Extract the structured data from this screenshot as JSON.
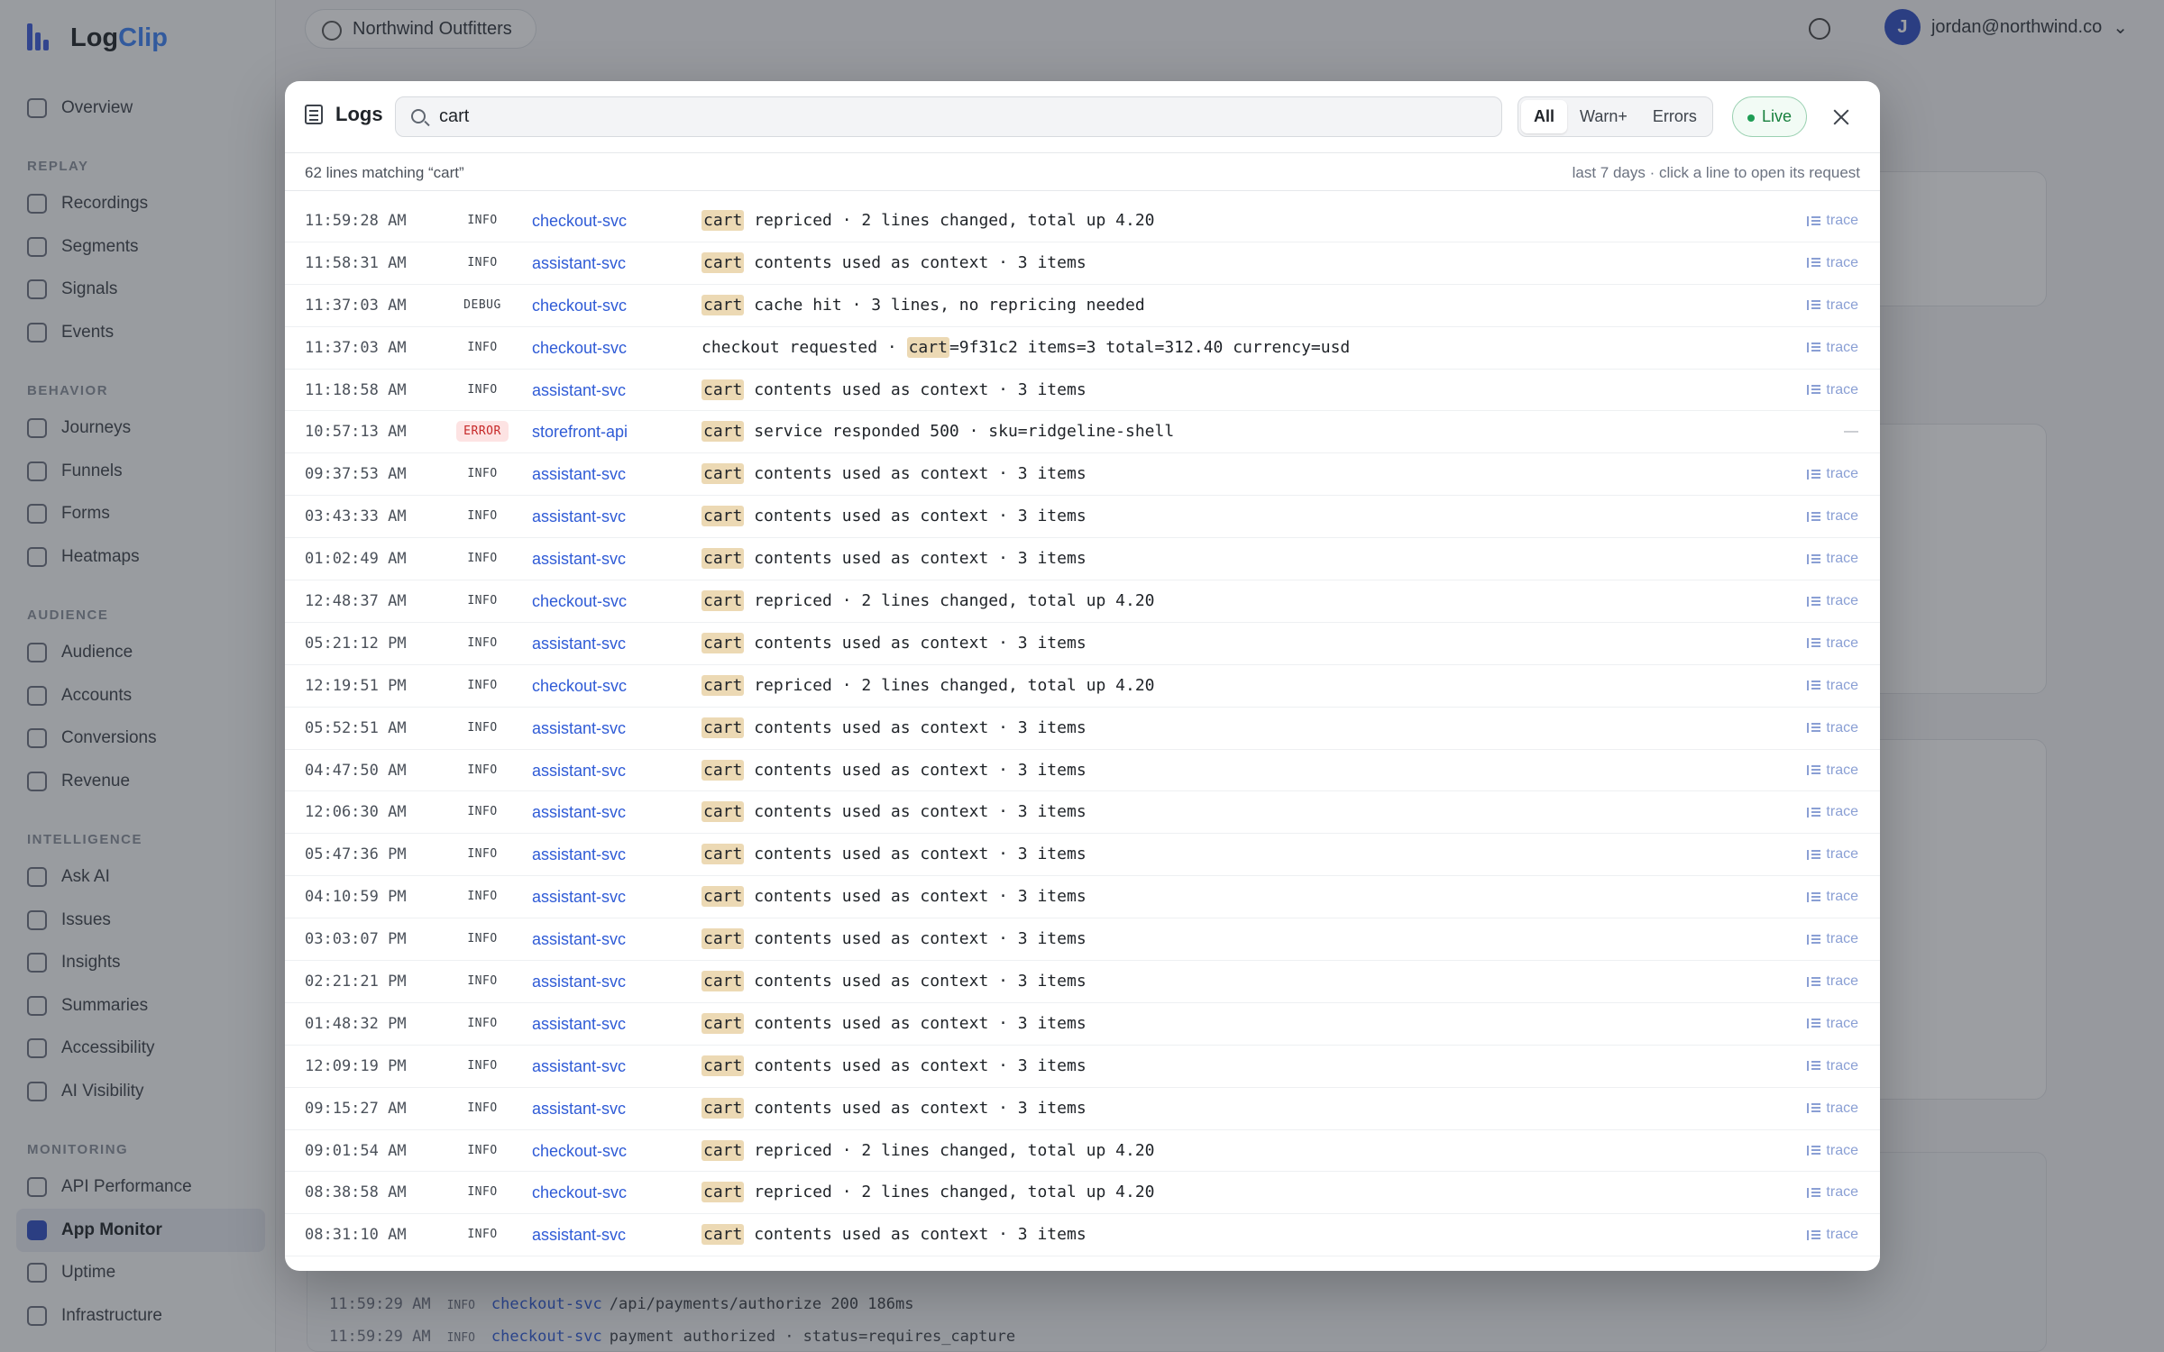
{
  "app": {
    "brand_part1": "Log",
    "brand_part2": "Clip",
    "org_name": "Northwind Outfitters",
    "user_email": "jordan@northwind.co",
    "user_initial": "J"
  },
  "sidebar": {
    "items_top": [
      {
        "label": "Overview"
      }
    ],
    "sections": [
      {
        "title": "REPLAY",
        "items": [
          {
            "label": "Recordings"
          },
          {
            "label": "Segments"
          },
          {
            "label": "Signals"
          },
          {
            "label": "Events"
          }
        ]
      },
      {
        "title": "BEHAVIOR",
        "items": [
          {
            "label": "Journeys"
          },
          {
            "label": "Funnels"
          },
          {
            "label": "Forms"
          },
          {
            "label": "Heatmaps"
          }
        ]
      },
      {
        "title": "AUDIENCE",
        "items": [
          {
            "label": "Audience"
          },
          {
            "label": "Accounts"
          },
          {
            "label": "Conversions"
          },
          {
            "label": "Revenue"
          }
        ]
      },
      {
        "title": "INTELLIGENCE",
        "items": [
          {
            "label": "Ask AI"
          },
          {
            "label": "Issues"
          },
          {
            "label": "Insights"
          },
          {
            "label": "Summaries"
          },
          {
            "label": "Accessibility"
          },
          {
            "label": "AI Visibility"
          }
        ]
      },
      {
        "title": "MONITORING",
        "items": [
          {
            "label": "API Performance"
          },
          {
            "label": "App Monitor",
            "active": true
          },
          {
            "label": "Uptime"
          },
          {
            "label": "Infrastructure"
          }
        ]
      }
    ]
  },
  "background": {
    "log_lines": [
      {
        "time": "11:59:29 AM",
        "level": "INFO",
        "service": "checkout-svc",
        "message": "/api/payments/authorize 200 186ms"
      },
      {
        "time": "11:59:29 AM",
        "level": "INFO",
        "service": "checkout-svc",
        "message": "payment authorized · status=requires_capture"
      }
    ]
  },
  "logs_modal": {
    "title": "Logs",
    "search_value": "cart",
    "filters": [
      {
        "label": "All",
        "active": true
      },
      {
        "label": "Warn+",
        "active": false
      },
      {
        "label": "Errors",
        "active": false
      }
    ],
    "live_label": "Live",
    "summary": "62 lines matching “cart”",
    "hint": "last 7 days · click a line to open its request",
    "trace_label": "trace",
    "no_trace": "—",
    "rows": [
      {
        "time": "11:59:28 AM",
        "level": "INFO",
        "service": "checkout-svc",
        "pre": "",
        "match": "cart",
        "post": " repriced · 2 lines changed, total up 4.20",
        "trace": true
      },
      {
        "time": "11:58:31 AM",
        "level": "INFO",
        "service": "assistant-svc",
        "pre": "",
        "match": "cart",
        "post": " contents used as context · 3 items",
        "trace": true
      },
      {
        "time": "11:37:03 AM",
        "level": "DEBUG",
        "service": "checkout-svc",
        "pre": "",
        "match": "cart",
        "post": " cache hit · 3 lines, no repricing needed",
        "trace": true
      },
      {
        "time": "11:37:03 AM",
        "level": "INFO",
        "service": "checkout-svc",
        "pre": "checkout requested · ",
        "match": "cart",
        "post": "=9f31c2 items=3 total=312.40 currency=usd",
        "trace": true
      },
      {
        "time": "11:18:58 AM",
        "level": "INFO",
        "service": "assistant-svc",
        "pre": "",
        "match": "cart",
        "post": " contents used as context · 3 items",
        "trace": true
      },
      {
        "time": "10:57:13 AM",
        "level": "ERROR",
        "service": "storefront-api",
        "pre": "",
        "match": "cart",
        "post": " service responded 500 · sku=ridgeline-shell",
        "trace": false
      },
      {
        "time": "09:37:53 AM",
        "level": "INFO",
        "service": "assistant-svc",
        "pre": "",
        "match": "cart",
        "post": " contents used as context · 3 items",
        "trace": true
      },
      {
        "time": "03:43:33 AM",
        "level": "INFO",
        "service": "assistant-svc",
        "pre": "",
        "match": "cart",
        "post": " contents used as context · 3 items",
        "trace": true
      },
      {
        "time": "01:02:49 AM",
        "level": "INFO",
        "service": "assistant-svc",
        "pre": "",
        "match": "cart",
        "post": " contents used as context · 3 items",
        "trace": true
      },
      {
        "time": "12:48:37 AM",
        "level": "INFO",
        "service": "checkout-svc",
        "pre": "",
        "match": "cart",
        "post": " repriced · 2 lines changed, total up 4.20",
        "trace": true
      },
      {
        "time": "05:21:12 PM",
        "level": "INFO",
        "service": "assistant-svc",
        "pre": "",
        "match": "cart",
        "post": " contents used as context · 3 items",
        "trace": true
      },
      {
        "time": "12:19:51 PM",
        "level": "INFO",
        "service": "checkout-svc",
        "pre": "",
        "match": "cart",
        "post": " repriced · 2 lines changed, total up 4.20",
        "trace": true
      },
      {
        "time": "05:52:51 AM",
        "level": "INFO",
        "service": "assistant-svc",
        "pre": "",
        "match": "cart",
        "post": " contents used as context · 3 items",
        "trace": true
      },
      {
        "time": "04:47:50 AM",
        "level": "INFO",
        "service": "assistant-svc",
        "pre": "",
        "match": "cart",
        "post": " contents used as context · 3 items",
        "trace": true
      },
      {
        "time": "12:06:30 AM",
        "level": "INFO",
        "service": "assistant-svc",
        "pre": "",
        "match": "cart",
        "post": " contents used as context · 3 items",
        "trace": true
      },
      {
        "time": "05:47:36 PM",
        "level": "INFO",
        "service": "assistant-svc",
        "pre": "",
        "match": "cart",
        "post": " contents used as context · 3 items",
        "trace": true
      },
      {
        "time": "04:10:59 PM",
        "level": "INFO",
        "service": "assistant-svc",
        "pre": "",
        "match": "cart",
        "post": " contents used as context · 3 items",
        "trace": true
      },
      {
        "time": "03:03:07 PM",
        "level": "INFO",
        "service": "assistant-svc",
        "pre": "",
        "match": "cart",
        "post": " contents used as context · 3 items",
        "trace": true
      },
      {
        "time": "02:21:21 PM",
        "level": "INFO",
        "service": "assistant-svc",
        "pre": "",
        "match": "cart",
        "post": " contents used as context · 3 items",
        "trace": true
      },
      {
        "time": "01:48:32 PM",
        "level": "INFO",
        "service": "assistant-svc",
        "pre": "",
        "match": "cart",
        "post": " contents used as context · 3 items",
        "trace": true
      },
      {
        "time": "12:09:19 PM",
        "level": "INFO",
        "service": "assistant-svc",
        "pre": "",
        "match": "cart",
        "post": " contents used as context · 3 items",
        "trace": true
      },
      {
        "time": "09:15:27 AM",
        "level": "INFO",
        "service": "assistant-svc",
        "pre": "",
        "match": "cart",
        "post": " contents used as context · 3 items",
        "trace": true
      },
      {
        "time": "09:01:54 AM",
        "level": "INFO",
        "service": "checkout-svc",
        "pre": "",
        "match": "cart",
        "post": " repriced · 2 lines changed, total up 4.20",
        "trace": true
      },
      {
        "time": "08:38:58 AM",
        "level": "INFO",
        "service": "checkout-svc",
        "pre": "",
        "match": "cart",
        "post": " repriced · 2 lines changed, total up 4.20",
        "trace": true
      },
      {
        "time": "08:31:10 AM",
        "level": "INFO",
        "service": "assistant-svc",
        "pre": "",
        "match": "cart",
        "post": " contents used as context · 3 items",
        "trace": true
      }
    ]
  }
}
